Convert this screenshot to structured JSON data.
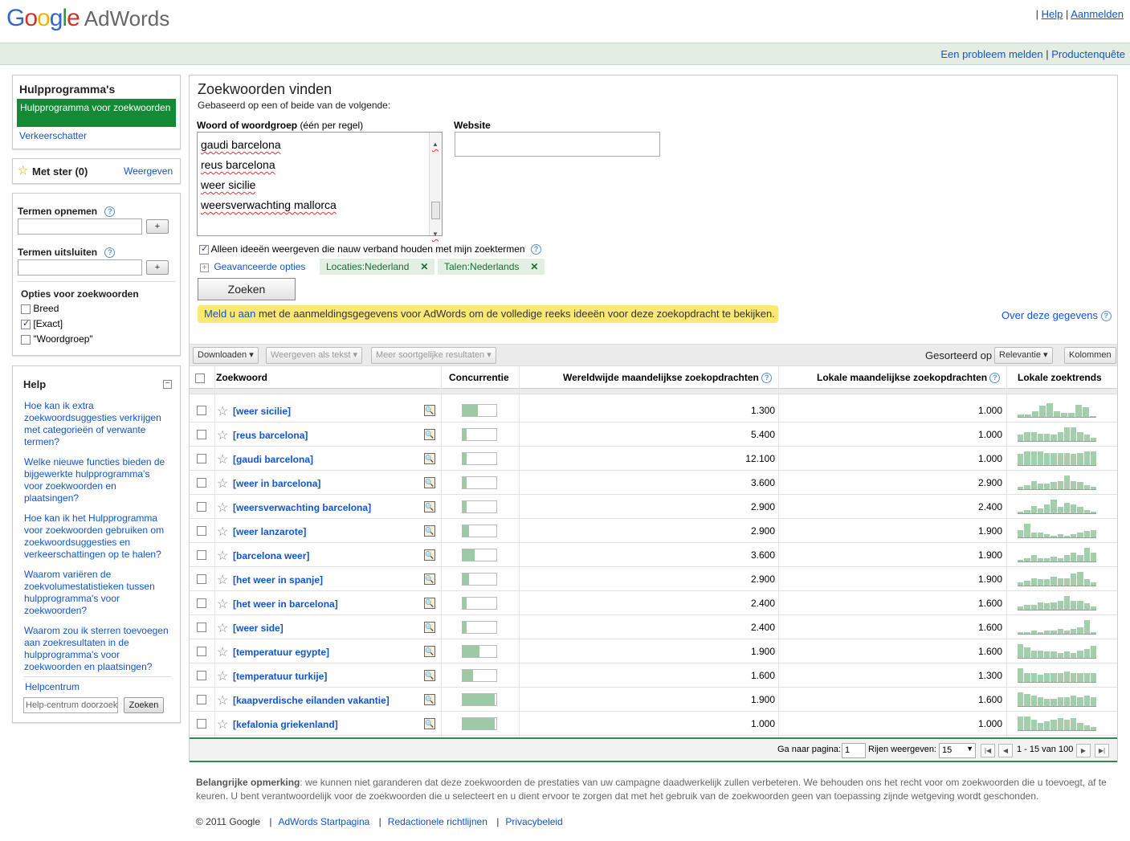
{
  "header": {
    "logo_google": "Google",
    "logo_product": "AdWords",
    "links": [
      "Help",
      "Aanmelden"
    ]
  },
  "subbar": {
    "links": [
      "Een probleem melden",
      "Productenquête"
    ]
  },
  "sidebar": {
    "tools_title": "Hulpprogramma's",
    "tools_selected": "Hulpprogramma voor zoekwoorden",
    "tools_other": "Verkeerschatter",
    "starred_label": "Met ster (0)",
    "starred_link": "Weergeven",
    "include_label": "Termen opnemen",
    "exclude_label": "Termen uitsluiten",
    "add_label": "+",
    "options_title": "Opties voor zoekwoorden",
    "options": [
      {
        "label": "Breed",
        "checked": false
      },
      {
        "label": "[Exact]",
        "checked": true
      },
      {
        "label": "\"Woordgroep\"",
        "checked": false
      }
    ],
    "help_title": "Help",
    "help_links": [
      "Hoe kan ik extra zoekwoordsuggesties verkrijgen met categorieën of verwante termen?",
      "Welke nieuwe functies bieden de bijgewerkte hulpprogramma's voor zoekwoorden en plaatsingen?",
      "Hoe kan ik het Hulpprogramma voor zoekwoorden gebruiken om zoekwoordsuggesties en verkeerschattingen op te halen?",
      "Waarom variëren de zoekvolumestatistieken tussen hulpprogramma's voor zoekwoorden?",
      "Waarom zou ik sterren toevoegen aan zoekresultaten in de hulpprogramma's voor zoekwoorden en plaatsingen?"
    ],
    "help_center": "Helpcentrum",
    "help_search_value": "Help-centrum doorzoeke",
    "help_search_btn": "Zoeken"
  },
  "main": {
    "title": "Zoekwoorden vinden",
    "subtitle": "Gebaseerd op een of beide van de volgende:",
    "words_label": "Woord of woordgroep",
    "words_hint": "(één per regel)",
    "website_label": "Website",
    "textarea_lines": [
      "gaudi barcelona",
      "reus barcelona",
      "weer sicilie",
      "weersverwachting mallorca"
    ],
    "closely_related": "Alleen ideeën weergeven die nauw verband houden met mijn zoektermen",
    "advanced": "Geavanceerde opties",
    "tag_locations": "Locaties:Nederland",
    "tag_languages": "Talen:Nederlands",
    "search_btn": "Zoeken",
    "signin_link": "Meld u aan",
    "signin_text": " met de aanmeldingsgegevens voor AdWords om de volledige reeks ideeën voor deze zoekopdracht te bekijken.",
    "about_data": "Over deze gegevens"
  },
  "toolbar": {
    "download": "Downloaden",
    "view_text": "Weergeven als tekst",
    "more_like": "Meer soortgelijke resultaten",
    "sorted_by": "Gesorteerd op",
    "sort_value": "Relevantie",
    "columns": "Kolommen"
  },
  "table": {
    "headers": {
      "keyword": "Zoekwoord",
      "competition": "Concurrentie",
      "global": "Wereldwijde maandelijkse zoekopdrachten",
      "local": "Lokale maandelijkse zoekopdrachten",
      "trends": "Lokale zoektrends"
    },
    "rows": [
      {
        "keyword": "[weer sicilie]",
        "competition": 0.45,
        "global": "1.300",
        "local": "1.000",
        "trend": [
          2,
          2,
          4,
          8,
          10,
          4,
          3,
          3,
          9,
          7,
          0
        ]
      },
      {
        "keyword": "[reus barcelona]",
        "competition": 0.12,
        "global": "5.400",
        "local": "1.000",
        "trend": [
          4,
          6,
          6,
          5,
          5,
          4,
          6,
          9,
          9,
          6,
          4,
          2
        ]
      },
      {
        "keyword": "[gaudi barcelona]",
        "competition": 0.12,
        "global": "12.100",
        "local": "1.000",
        "trend": [
          8,
          10,
          10,
          10,
          9,
          9,
          9,
          9,
          8,
          9,
          10,
          10
        ]
      },
      {
        "keyword": "[weer in barcelona]",
        "competition": 0.12,
        "global": "3.600",
        "local": "2.900",
        "trend": [
          2,
          3,
          6,
          4,
          4,
          5,
          6,
          10,
          6,
          5,
          3,
          2
        ]
      },
      {
        "keyword": "[weersverwachting barcelona]",
        "competition": 0.12,
        "global": "2.900",
        "local": "2.400",
        "trend": [
          1,
          2,
          5,
          3,
          6,
          9,
          4,
          7,
          6,
          4,
          2,
          1
        ]
      },
      {
        "keyword": "[weer lanzarote]",
        "competition": 0.2,
        "global": "2.900",
        "local": "1.900",
        "trend": [
          5,
          9,
          3,
          3,
          2,
          1,
          2,
          1,
          2,
          3,
          4,
          5
        ]
      },
      {
        "keyword": "[barcelona weer]",
        "competition": 0.35,
        "global": "3.600",
        "local": "1.900",
        "trend": [
          1,
          2,
          4,
          2,
          2,
          3,
          2,
          4,
          6,
          4,
          9,
          6
        ]
      },
      {
        "keyword": "[het weer in spanje]",
        "competition": 0.2,
        "global": "2.900",
        "local": "1.900",
        "trend": [
          2,
          3,
          5,
          4,
          4,
          6,
          5,
          5,
          8,
          9,
          4,
          2
        ]
      },
      {
        "keyword": "[het weer in barcelona]",
        "competition": 0.12,
        "global": "2.400",
        "local": "1.600",
        "trend": [
          2,
          3,
          3,
          5,
          4,
          5,
          6,
          9,
          6,
          6,
          4,
          2
        ]
      },
      {
        "keyword": "[weer side]",
        "competition": 0.12,
        "global": "2.400",
        "local": "1.600",
        "trend": [
          1,
          1,
          2,
          1,
          2,
          2,
          3,
          2,
          3,
          4,
          9,
          1
        ]
      },
      {
        "keyword": "[temperatuur egypte]",
        "competition": 0.5,
        "global": "1.900",
        "local": "1.600",
        "trend": [
          9,
          7,
          5,
          5,
          4,
          4,
          3,
          4,
          3,
          5,
          6,
          8
        ]
      },
      {
        "keyword": "[temperatuur turkije]",
        "competition": 0.3,
        "global": "1.600",
        "local": "1.300",
        "trend": [
          9,
          6,
          6,
          5,
          6,
          6,
          6,
          7,
          6,
          6,
          6,
          6
        ]
      },
      {
        "keyword": "[kaapverdische eilanden vakantie]",
        "competition": 0.95,
        "global": "1.900",
        "local": "1.600",
        "trend": [
          9,
          8,
          7,
          6,
          5,
          5,
          6,
          6,
          7,
          6,
          7,
          6
        ]
      },
      {
        "keyword": "[kefalonia griekenland]",
        "competition": 0.95,
        "global": "1.000",
        "local": "1.000",
        "trend": [
          9,
          9,
          7,
          5,
          6,
          7,
          8,
          7,
          8,
          5,
          3,
          2
        ]
      }
    ]
  },
  "pager": {
    "goto_label": "Ga naar pagina:",
    "page_value": "1",
    "rows_label": "Rijen weergeven:",
    "rows_value": "15",
    "range": "1 - 15 van 100"
  },
  "footer": {
    "note_bold": "Belangrijke opmerking",
    "note_text": ": we kunnen niet garanderen dat deze zoekwoorden de prestaties van uw campagne daadwerkelijk zullen verbeteren. We behouden ons het recht voor om zoekwoorden die u toevoegt, af te keuren. U bent verantwoordelijk voor de zoekwoorden die u selecteert en u dient ervoor te zorgen dat met het gebruik van de zoekwoorden geen van toepassing zijnde wetgeving wordt geschonden.",
    "copyright": "© 2011 Google",
    "links": [
      "AdWords Startpagina",
      "Redactionele richtlijnen",
      "Privacybeleid"
    ]
  },
  "colors": {
    "accent_green": "#138a36",
    "bar_green": "#9cc9a6",
    "link": "#1155cc",
    "highlight": "#fbe974"
  }
}
